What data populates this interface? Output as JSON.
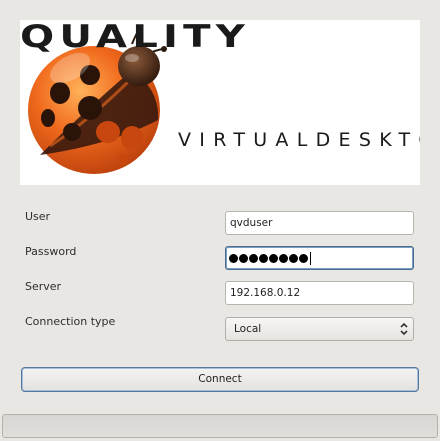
{
  "logo": {
    "brand": "QUALITY",
    "subtitle": "VIRTUALDESKTOP",
    "mascot": "ladybug-icon",
    "colors": {
      "mascot_orange": "#e8581a",
      "mascot_dark": "#3b1f12",
      "wordmark": "#1a1a1a"
    }
  },
  "form": {
    "user": {
      "label": "User",
      "value": "qvduser"
    },
    "password": {
      "label": "Password",
      "masked_length": 8
    },
    "server": {
      "label": "Server",
      "value": "192.168.0.12"
    },
    "connection_type": {
      "label": "Connection type",
      "selected": "Local"
    }
  },
  "actions": {
    "connect_label": "Connect"
  },
  "progress": {
    "value": 0
  },
  "colors": {
    "window_bg": "#e9e7e4",
    "focus_border": "#4a6c8e"
  }
}
